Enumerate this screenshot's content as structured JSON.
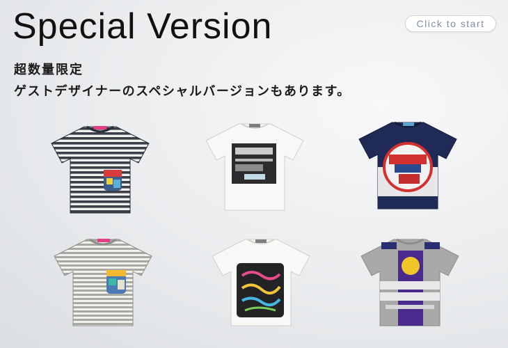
{
  "title": "Special Version",
  "start_button": "Click to start",
  "subtitle_line1": "超数量限定",
  "subtitle_line2": "ゲストデザイナーのスペシャルバージョンもあります。",
  "products": [
    {
      "name": "striped-pocket-tee"
    },
    {
      "name": "white-graphic-tee"
    },
    {
      "name": "navy-patch-tee"
    },
    {
      "name": "grey-stripe-pocket-tee"
    },
    {
      "name": "white-sunday-morning-walk-tee"
    },
    {
      "name": "grey-digger-tee"
    }
  ],
  "colors": {
    "title": "#111111",
    "button_text": "#7c8ea5",
    "background": "#eceef0"
  }
}
